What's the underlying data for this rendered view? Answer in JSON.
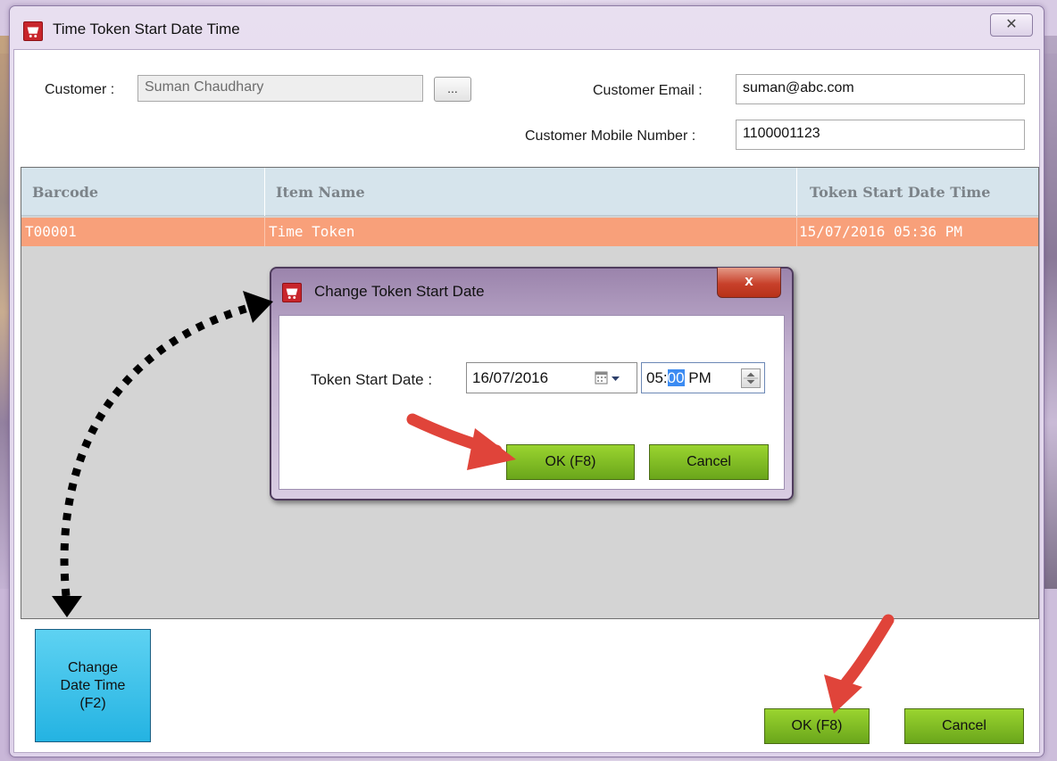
{
  "window": {
    "title": "Time Token Start Date Time",
    "close_glyph": "✕"
  },
  "customer": {
    "label": "Customer :",
    "value": "Suman Chaudhary",
    "browse_label": "...",
    "email_label": "Customer Email :",
    "email_value": "suman@abc.com",
    "mobile_label": "Customer Mobile Number :",
    "mobile_value": "1100001123"
  },
  "grid": {
    "columns": [
      "Barcode",
      "Item Name",
      "Token Start Date Time"
    ],
    "rows": [
      [
        "T00001",
        "Time Token",
        "15/07/2016 05:36 PM"
      ]
    ]
  },
  "buttons": {
    "change_line1": "Change",
    "change_line2": "Date Time",
    "change_line3": "(F2)",
    "ok": "OK (F8)",
    "cancel": "Cancel"
  },
  "dialog": {
    "title": "Change Token Start Date",
    "close_glyph": "x",
    "date_label": "Token Start Date :",
    "date_value": "16/07/2016",
    "time_hour": "05:",
    "time_minute": "00",
    "time_ampm": " PM",
    "ok": "OK (F8)",
    "cancel": "Cancel"
  },
  "icons": [
    "cart-icon",
    "calendar-icon",
    "dropdown-arrow-icon",
    "spinner-icon",
    "close-icon"
  ],
  "colors": {
    "selected_row": "#f8a07a",
    "grid_header": "#d6e4ec",
    "green_button": "#7cbc22",
    "tile_button": "#2fbbe6",
    "arrow_red": "#e0443a"
  }
}
